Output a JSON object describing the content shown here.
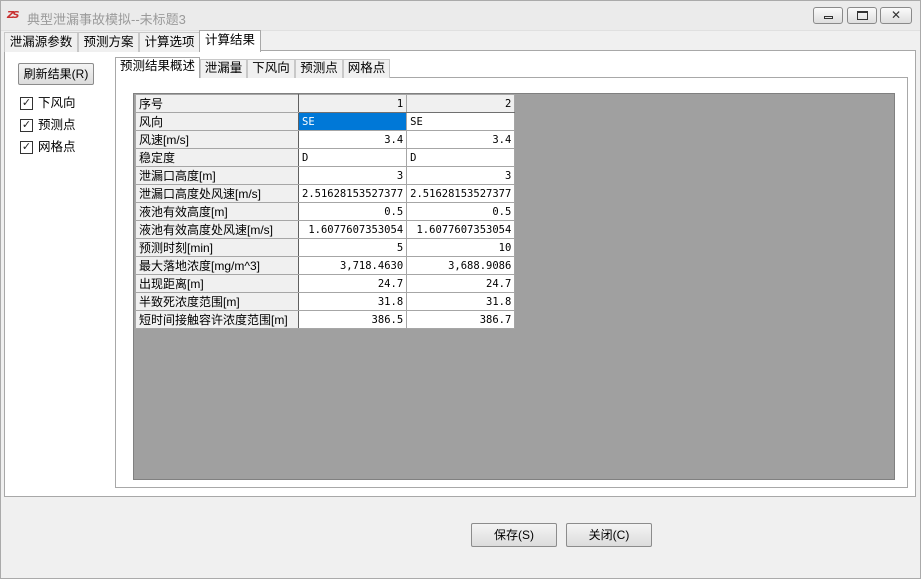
{
  "window": {
    "icon": "app-logo-icon",
    "title": "典型泄漏事故模拟--未标题3",
    "controls": [
      "minimize-icon",
      "maximize-icon",
      "close-icon"
    ]
  },
  "main_tabs": [
    "泄漏源参数",
    "预测方案",
    "计算选项",
    "计算结果"
  ],
  "active_main_tab": "计算结果",
  "sidebar": {
    "refresh_label": "刷新结果(R)",
    "checkboxes": [
      {
        "label": "下风向",
        "checked": true
      },
      {
        "label": "预测点",
        "checked": true
      },
      {
        "label": "网格点",
        "checked": true
      }
    ]
  },
  "sub_tabs": [
    "预测结果概述",
    "泄漏量",
    "下风向",
    "预测点",
    "网格点"
  ],
  "active_sub_tab": "预测结果概述",
  "table": {
    "header_label": "序号",
    "columns": [
      "1",
      "2"
    ],
    "rows": [
      {
        "label": "风向",
        "values": [
          "SE",
          "SE"
        ]
      },
      {
        "label": "风速[m/s]",
        "values": [
          "3.4",
          "3.4"
        ]
      },
      {
        "label": "稳定度",
        "values": [
          "D",
          "D"
        ]
      },
      {
        "label": "泄漏口高度[m]",
        "values": [
          "3",
          "3"
        ]
      },
      {
        "label": "泄漏口高度处风速[m/s]",
        "values": [
          "2.51628153527377",
          "2.51628153527377"
        ]
      },
      {
        "label": "液池有效高度[m]",
        "values": [
          "0.5",
          "0.5"
        ]
      },
      {
        "label": "液池有效高度处风速[m/s]",
        "values": [
          "1.6077607353054",
          "1.6077607353054"
        ]
      },
      {
        "label": "预测时刻[min]",
        "values": [
          "5",
          "10"
        ]
      },
      {
        "label": "最大落地浓度[mg/m^3]",
        "values": [
          "3,718.4630",
          "3,688.9086"
        ]
      },
      {
        "label": "出现距离[m]",
        "values": [
          "24.7",
          "24.7"
        ]
      },
      {
        "label": "半致死浓度范围[m]",
        "values": [
          "31.8",
          "31.8"
        ]
      },
      {
        "label": "短时间接触容许浓度范围[m]",
        "values": [
          "386.5",
          "386.7"
        ]
      }
    ]
  },
  "buttons": {
    "save": "保存(S)",
    "close": "关闭(C)"
  },
  "colors": {
    "selection": "#0078d7",
    "grid_background": "#a0a0a0",
    "window_background": "#f0f0f0"
  }
}
